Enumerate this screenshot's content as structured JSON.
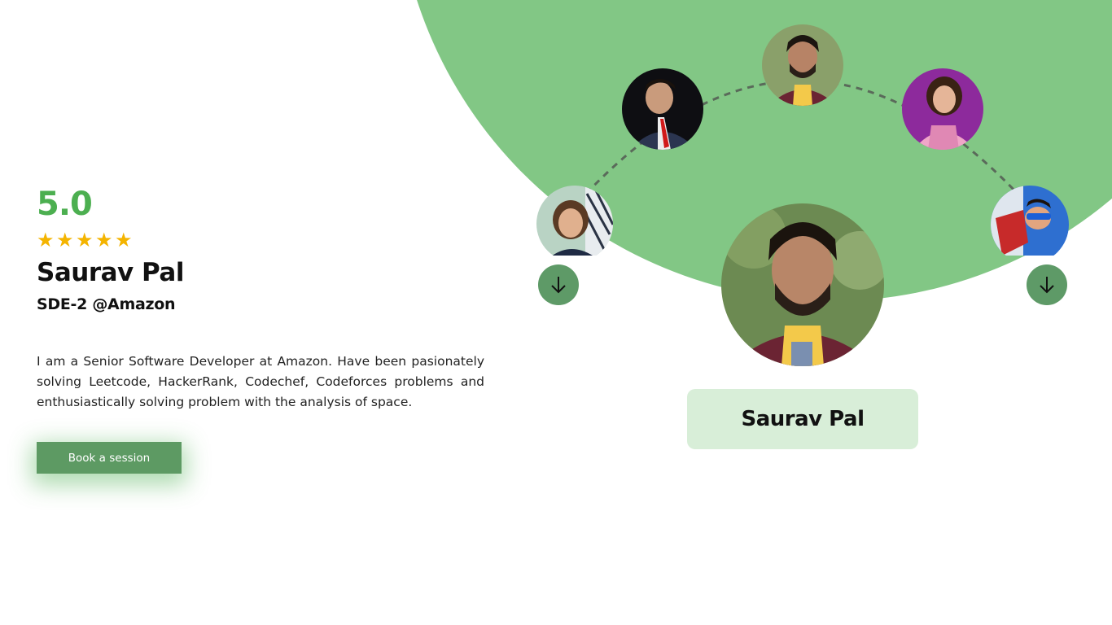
{
  "profile": {
    "rating": "5.0",
    "stars": 5,
    "name": "Saurav Pal",
    "role": "SDE-2 @Amazon",
    "bio": "I am a Senior Software Developer at Amazon. Have been pasionately solving Leetcode, HackerRank, Codechef, Codeforces problems and enthusiastically solving problem with the analysis of space.",
    "cta_label": "Book a session"
  },
  "carousel": {
    "selected_name": "Saurav Pal",
    "mentors": [
      {
        "icon": "mentor-avatar-1",
        "bg": "#b9d3c4"
      },
      {
        "icon": "mentor-avatar-2",
        "bg": "#0e0e12"
      },
      {
        "icon": "mentor-avatar-3",
        "bg": "#8aa06a"
      },
      {
        "icon": "mentor-avatar-4",
        "bg": "#8d2a9c"
      },
      {
        "icon": "mentor-avatar-5",
        "bg": "#2e6fd0"
      }
    ],
    "prev_icon": "arrow-down-icon",
    "next_icon": "arrow-down-icon"
  },
  "colors": {
    "accent": "#82c785",
    "rating": "#4caf50",
    "button": "#5d9a63",
    "star": "#f4b400",
    "card": "#d8eed8"
  }
}
